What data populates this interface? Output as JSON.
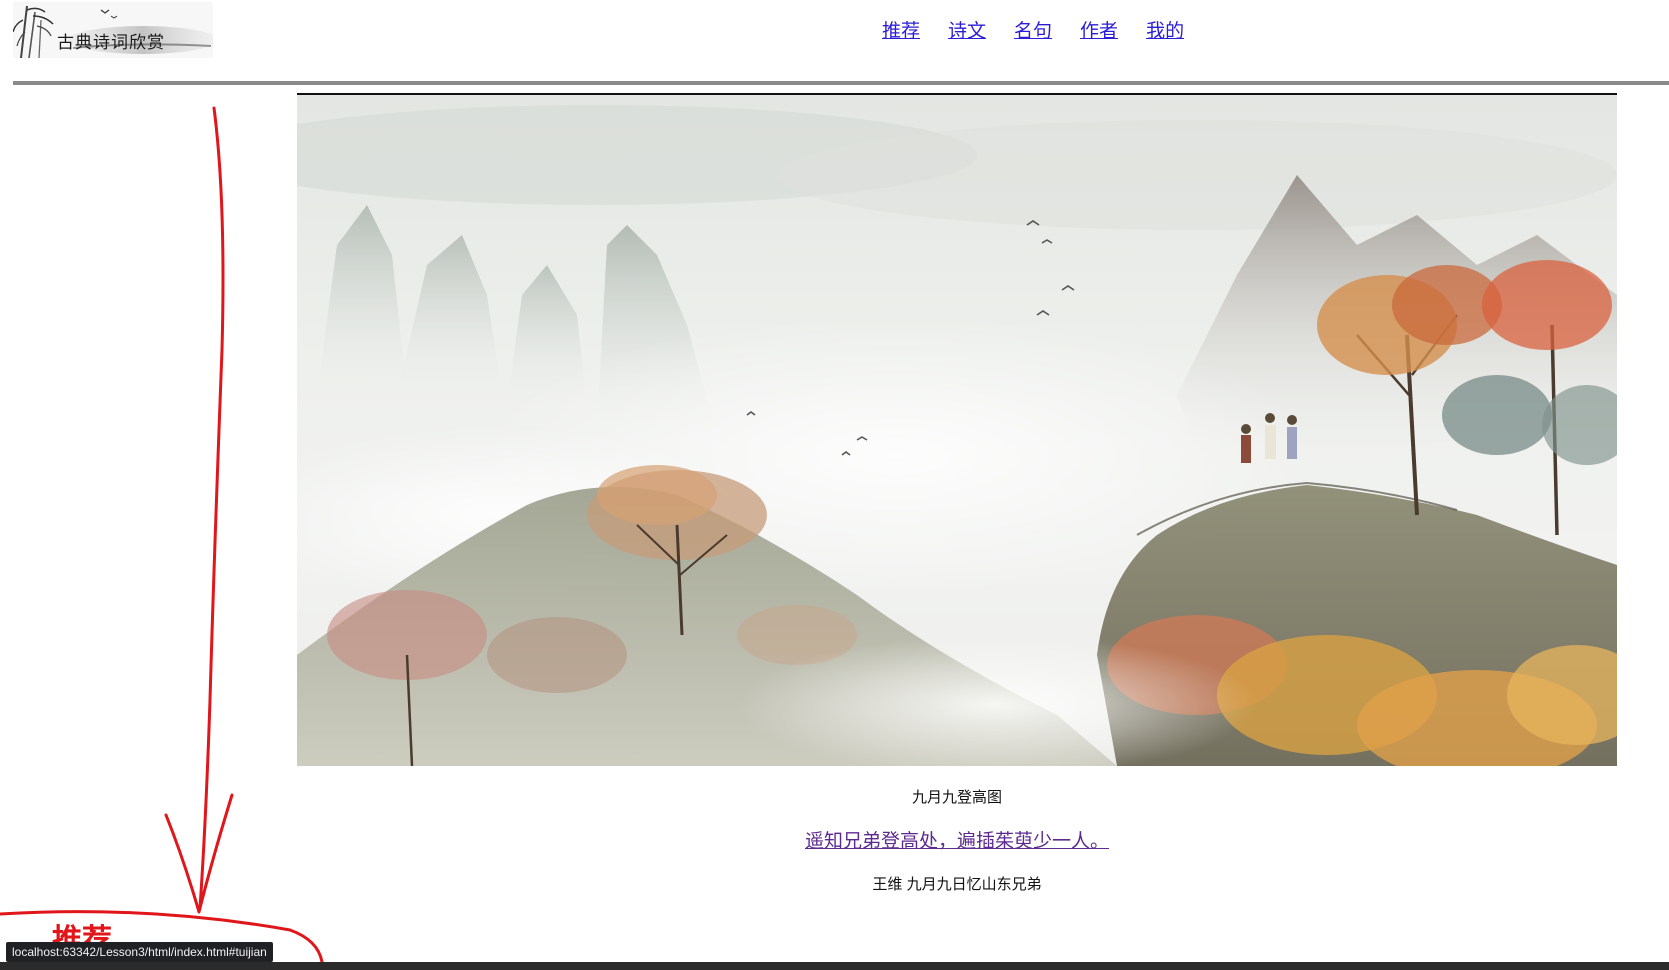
{
  "header": {
    "logo_text": "古典诗词欣赏",
    "nav": [
      {
        "label": "推荐"
      },
      {
        "label": "诗文"
      },
      {
        "label": "名句"
      },
      {
        "label": "作者"
      },
      {
        "label": "我的"
      }
    ]
  },
  "feature": {
    "image_caption": "九月九登高图",
    "verse_link": "遥知兄弟登高处，遍插茱萸少一人。",
    "author_line": "王维 九月九日忆山东兄弟"
  },
  "annotation": {
    "label": "推荐",
    "color": "#e0161b"
  },
  "status_bar": {
    "url": "localhost:63342/Lesson3/html/index.html#tuijian"
  },
  "colors": {
    "link": "#2b1dd6",
    "visited_link": "#5c2a8f",
    "rule": "#8a8a8a"
  }
}
